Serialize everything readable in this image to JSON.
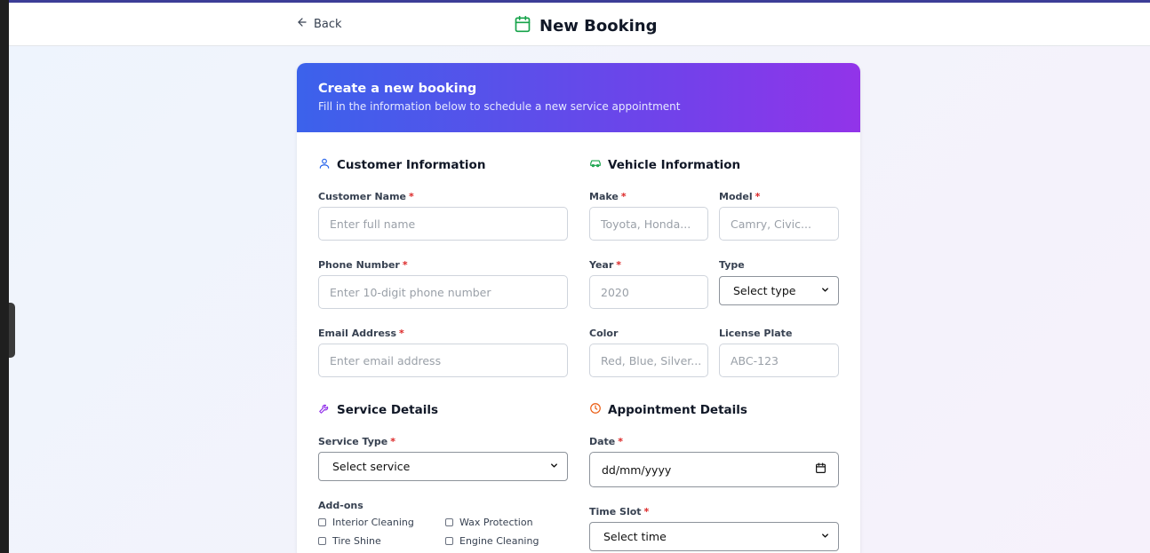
{
  "header": {
    "back_label": "Back",
    "title": "New Booking"
  },
  "card": {
    "title": "Create a new booking",
    "subtitle": "Fill in the information below to schedule a new service appointment"
  },
  "customer": {
    "section_title": "Customer Information",
    "name_label": "Customer Name",
    "name_placeholder": "Enter full name",
    "phone_label": "Phone Number",
    "phone_placeholder": "Enter 10-digit phone number",
    "email_label": "Email Address",
    "email_placeholder": "Enter email address",
    "required_mark": "*"
  },
  "vehicle": {
    "section_title": "Vehicle Information",
    "make_label": "Make",
    "make_placeholder": "Toyota, Honda...",
    "model_label": "Model",
    "model_placeholder": "Camry, Civic...",
    "year_label": "Year",
    "year_placeholder": "2020",
    "type_label": "Type",
    "type_value": "Select type",
    "color_label": "Color",
    "color_placeholder": "Red, Blue, Silver...",
    "plate_label": "License Plate",
    "plate_placeholder": "ABC-123"
  },
  "service": {
    "section_title": "Service Details",
    "type_label": "Service Type",
    "type_value": "Select service",
    "addons_label": "Add-ons",
    "addons": [
      "Interior Cleaning",
      "Wax Protection",
      "Tire Shine",
      "Engine Cleaning"
    ]
  },
  "appointment": {
    "section_title": "Appointment Details",
    "date_label": "Date",
    "date_value": "dd/mm/yyyy",
    "time_label": "Time Slot",
    "time_value": "Select time"
  },
  "colors": {
    "accent_border": "#3c3d97",
    "gradient_start": "#3b62eb",
    "gradient_end": "#9234e9",
    "calendar_icon": "#16a34a",
    "user_icon": "#2563eb",
    "car_icon": "#16a34a",
    "wrench_icon": "#9333ea",
    "clock_icon": "#ea580c",
    "required": "#dc2626"
  },
  "icons": {
    "back": "arrow-left-icon",
    "title": "calendar-icon",
    "customer": "user-icon",
    "vehicle": "car-icon",
    "service": "wrench-icon",
    "appointment": "clock-icon"
  }
}
